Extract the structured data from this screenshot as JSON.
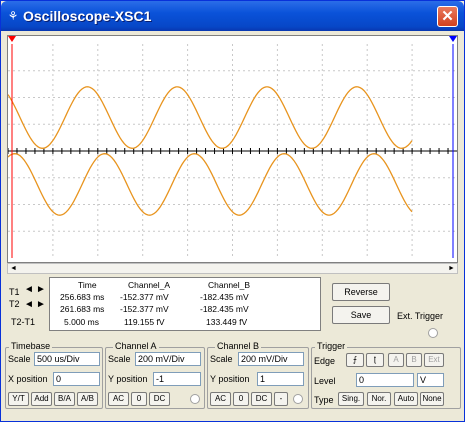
{
  "window": {
    "title": "Oscilloscope-XSC1"
  },
  "colors": {
    "trace": "#e8941e",
    "grid": "#c8c8c8",
    "axis": "#000000",
    "t1_cursor": "#ff0000",
    "t2_cursor": "#0000ff"
  },
  "scroll": {
    "left_icon": "◄",
    "right_icon": "►"
  },
  "readout": {
    "cursor_labels": [
      "T1",
      "T2",
      "T2-T1"
    ],
    "headers": {
      "time": "Time",
      "channel_a": "Channel_A",
      "channel_b": "Channel_B"
    },
    "rows": [
      {
        "time": "256.683 ms",
        "a": "-152.377 mV",
        "b": "-182.435 mV"
      },
      {
        "time": "261.683 ms",
        "a": "-152.377 mV",
        "b": "-182.435 mV"
      },
      {
        "time": "5.000 ms",
        "a": "119.155 fV",
        "b": "133.449 fV"
      }
    ]
  },
  "buttons": {
    "reverse": "Reverse",
    "save": "Save",
    "ext_trigger": "Ext. Trigger"
  },
  "timebase": {
    "title": "Timebase",
    "scale_label": "Scale",
    "scale_value": "500 us/Div",
    "xpos_label": "X position",
    "xpos_value": "0",
    "modes": [
      "Y/T",
      "Add",
      "B/A",
      "A/B"
    ]
  },
  "channel_a": {
    "title": "Channel A",
    "scale_label": "Scale",
    "scale_value": "200 mV/Div",
    "ypos_label": "Y position",
    "ypos_value": "-1",
    "coupling": [
      "AC",
      "0",
      "DC"
    ]
  },
  "channel_b": {
    "title": "Channel B",
    "scale_label": "Scale",
    "scale_value": "200 mV/Div",
    "ypos_label": "Y position",
    "ypos_value": "1",
    "coupling": [
      "AC",
      "0",
      "DC",
      "-"
    ]
  },
  "trigger": {
    "title": "Trigger",
    "edge_label": "Edge",
    "sources": [
      "A",
      "B",
      "Ext"
    ],
    "level_label": "Level",
    "level_value": "0",
    "level_unit": "V",
    "type_label": "Type",
    "types": [
      "Sing.",
      "Nor.",
      "Auto",
      "None"
    ]
  }
}
